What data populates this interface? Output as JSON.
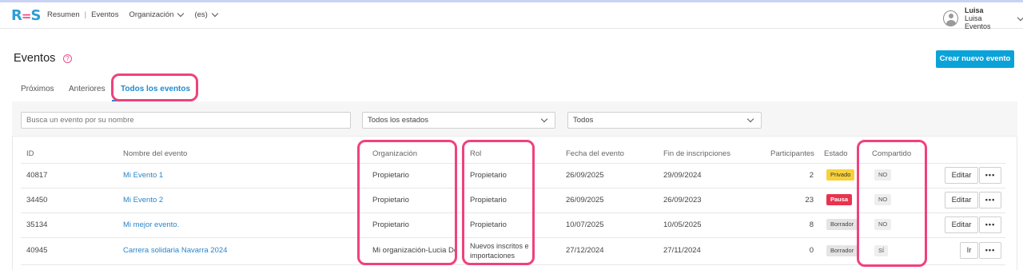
{
  "header": {
    "logo": {
      "r": "R",
      "mid": "=",
      "s": "S"
    },
    "nav": {
      "resumen": "Resumen",
      "separator": "|",
      "eventos": "Eventos",
      "organizacion": "Organización",
      "language": "(es)"
    },
    "user": {
      "name": "Luisa",
      "org": "Luisa Eventos"
    }
  },
  "page": {
    "title": "Eventos",
    "help": "?",
    "create_button": "Crear nuevo evento"
  },
  "tabs": [
    {
      "label": "Próximos"
    },
    {
      "label": "Anteriores"
    },
    {
      "label": "Todos los eventos",
      "active": true
    }
  ],
  "filters": {
    "search_placeholder": "Busca un evento por su nombre",
    "status_selected": "Todos los estados",
    "type_selected": "Todos"
  },
  "table": {
    "headers": [
      "ID",
      "Nombre del evento",
      "Organización",
      "Rol",
      "Fecha del evento",
      "Fin de inscripciones",
      "Participantes",
      "Estado",
      "Compartido"
    ],
    "rows": [
      {
        "id": "40817",
        "name": "Mi Evento 1",
        "org": "Propietario",
        "rol": "Propietario",
        "fecha": "26/09/2025",
        "fin": "29/09/2024",
        "participantes": "2",
        "estado": "Privado",
        "compartido": "NO",
        "action": "Editar",
        "more": "•••"
      },
      {
        "id": "34450",
        "name": "Mi Evento 2",
        "org": "Propietario",
        "rol": "Propietario",
        "fecha": "26/09/2025",
        "fin": "26/09/2023",
        "participantes": "23",
        "estado": "Pausa",
        "compartido": "NO",
        "action": "Editar",
        "more": "•••"
      },
      {
        "id": "35134",
        "name": "Mi mejor evento.",
        "org": "Propietario",
        "rol": "Propietario",
        "fecha": "10/07/2025",
        "fin": "10/05/2025",
        "participantes": "8",
        "estado": "Borrador",
        "compartido": "NO",
        "action": "Editar",
        "more": "•••"
      },
      {
        "id": "40945",
        "name": "Carrera solidaria Navarra 2024",
        "org": "Mi organización-Lucia Demo",
        "rol": "Nuevos inscritos e importaciones",
        "fecha": "27/12/2024",
        "fin": "27/11/2024",
        "participantes": "0",
        "estado": "Borrador",
        "compartido": "SÍ",
        "action": "Ir",
        "more": "•••"
      }
    ]
  },
  "colors": {
    "accent": "#0aa3d9",
    "link": "#2a86c8",
    "highlight": "#f0427a",
    "privado": "#f8d13a",
    "pausa": "#e8334f"
  }
}
